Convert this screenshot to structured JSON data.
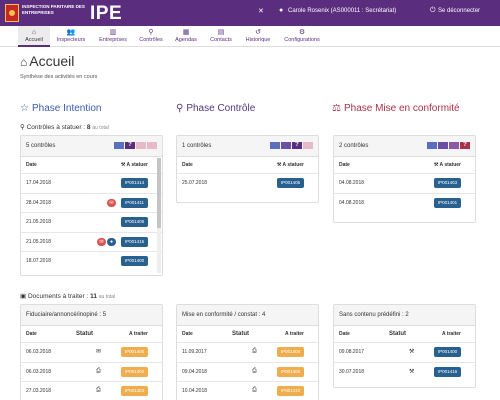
{
  "header": {
    "logo_text": "Inspection Paritaire des Entreprises",
    "logo_word": "IPE",
    "user_label": "Carole Rosenix (AS000011 : Secrétariat)",
    "logout_label": "Se déconnecter",
    "icons": [
      "tools-icon",
      "user-icon",
      "power-icon"
    ]
  },
  "nav": [
    {
      "label": "Accueil",
      "icon": "home"
    },
    {
      "label": "Inspecteurs",
      "icon": "users"
    },
    {
      "label": "Entreprises",
      "icon": "building"
    },
    {
      "label": "Contrôles",
      "icon": "search"
    },
    {
      "label": "Agendas",
      "icon": "calendar"
    },
    {
      "label": "Contacts",
      "icon": "card"
    },
    {
      "label": "Historique",
      "icon": "history"
    },
    {
      "label": "Configurations",
      "icon": "gears"
    }
  ],
  "page": {
    "title": "Accueil",
    "subtitle": "Synthèse des activités en cours"
  },
  "phases": {
    "intention": {
      "label": "Phase Intention",
      "color": "#3a5ca8"
    },
    "controle": {
      "label": "Phase Contrôle",
      "color": "#4a3a7a"
    },
    "conformite": {
      "label": "Phase Mise en conformité",
      "color": "#a8324a"
    }
  },
  "controles": {
    "heading": "Contrôles à statuer",
    "count": "8",
    "total": "au total"
  },
  "documents": {
    "heading": "Documents à traiter",
    "count": "11",
    "total": "au total"
  },
  "controle_panels": [
    {
      "title": "5 contrôles",
      "col_date": "Date",
      "col_action": "A statuer",
      "rows": [
        {
          "date": "17.04.2018",
          "id": "IP001414"
        },
        {
          "date": "28.04.2018",
          "id": "IP001411",
          "flags": [
            "mail"
          ]
        },
        {
          "date": "21.05.2018",
          "id": "IP001408"
        },
        {
          "date": "21.05.2018",
          "id": "IP001415",
          "flags": [
            "mail",
            "user"
          ]
        },
        {
          "date": "18.07.2018",
          "id": "IP001400"
        }
      ]
    },
    {
      "title": "1 contrôles",
      "col_date": "Date",
      "col_action": "A statuer",
      "rows": [
        {
          "date": "25.07.2018",
          "id": "IP001405"
        }
      ]
    },
    {
      "title": "2 contrôles",
      "col_date": "Date",
      "col_action": "A statuer",
      "rows": [
        {
          "date": "04.08.2018",
          "id": "IP001403"
        },
        {
          "date": "04.08.2018",
          "id": "IP001401"
        }
      ]
    }
  ],
  "document_panels": [
    {
      "title": "Fiduciaire/annoncé/inopiné : 5",
      "col_date": "Date",
      "col_statut": "Statut",
      "col_action": "A traiter",
      "rows": [
        {
          "date": "06.03.2018",
          "statut": "envelope",
          "id": "IP001400",
          "btn": "orange"
        },
        {
          "date": "06.03.2018",
          "statut": "printer",
          "id": "IP001402",
          "btn": "orange"
        },
        {
          "date": "27.03.2018",
          "statut": "printer",
          "id": "IP001404",
          "btn": "orange"
        }
      ]
    },
    {
      "title": "Mise en conformité / constat : 4",
      "col_date": "Date",
      "col_statut": "Statut",
      "col_action": "A traiter",
      "rows": [
        {
          "date": "11.09.2017",
          "statut": "printer",
          "id": "IP001404",
          "btn": "orange"
        },
        {
          "date": "09.04.2018",
          "statut": "printer",
          "id": "IP001406",
          "btn": "orange"
        },
        {
          "date": "10.04.2018",
          "statut": "printer",
          "id": "IP001410",
          "btn": "orange"
        }
      ]
    },
    {
      "title": "Sans contenu prédéfini : 2",
      "col_date": "Date",
      "col_statut": "Statut",
      "col_action": "A traiter",
      "rows": [
        {
          "date": "09.08.2017",
          "statut": "gavel",
          "id": "IP001400",
          "btn": "blue"
        },
        {
          "date": "30.07.2018",
          "statut": "gavel",
          "id": "IP001416",
          "btn": "blue"
        }
      ]
    }
  ]
}
